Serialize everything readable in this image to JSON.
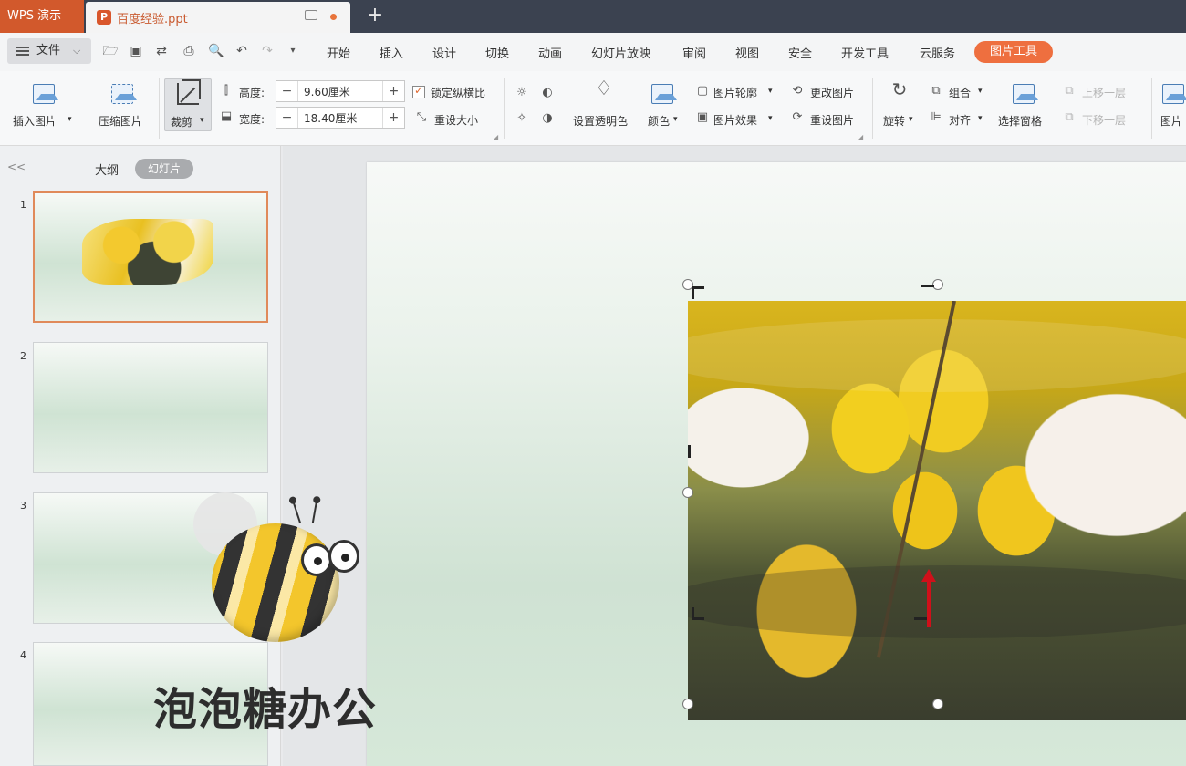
{
  "tabbar": {
    "app_name": "WPS 演示",
    "doc_name": "百度经验.ppt",
    "doc_icon_letter": "P",
    "new_tab": "+"
  },
  "menu": {
    "file": "文件",
    "items": [
      "开始",
      "插入",
      "设计",
      "切换",
      "动画",
      "幻灯片放映",
      "审阅",
      "视图",
      "安全",
      "开发工具",
      "云服务"
    ],
    "active": "图片工具"
  },
  "ribbon": {
    "insert_picture": "插入图片",
    "compress_picture": "压缩图片",
    "crop": "裁剪",
    "height_label": "高度:",
    "height_value": "9.60厘米",
    "width_label": "宽度:",
    "width_value": "18.40厘米",
    "lock_ratio": "锁定纵横比",
    "reset_size": "重设大小",
    "set_transparent": "设置透明色",
    "color": "颜色",
    "picture_outline": "图片轮廓",
    "picture_effects": "图片效果",
    "change_picture": "更改图片",
    "reset_picture": "重设图片",
    "rotate": "旋转",
    "group": "组合",
    "align": "对齐",
    "selection_pane": "选择窗格",
    "bring_forward": "上移一层",
    "send_backward": "下移一层",
    "picture_more": "图片"
  },
  "panel": {
    "collapse": "<<",
    "tab_outline": "大纲",
    "tab_slides": "幻灯片",
    "slides": [
      "1",
      "2",
      "3",
      "4"
    ]
  },
  "watermark": "泡泡糖办公",
  "colors": {
    "accent": "#ee6f3f",
    "app_tab": "#d2592c",
    "tabbar_bg": "#3b4250"
  }
}
